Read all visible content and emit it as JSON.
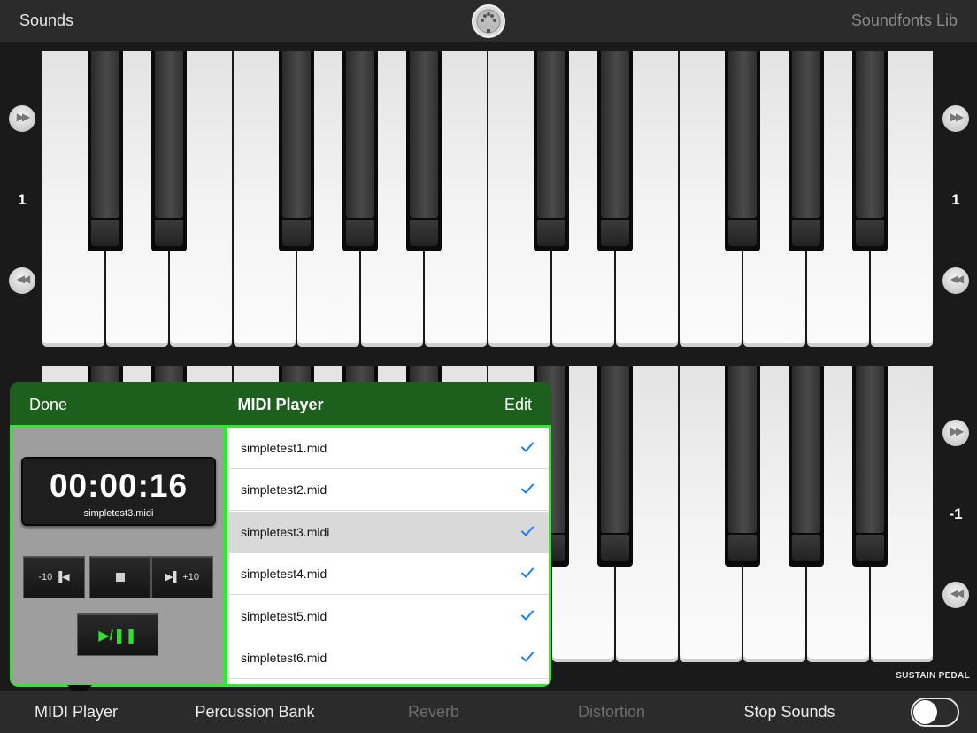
{
  "topbar": {
    "left_label": "Sounds",
    "right_label": "Soundfonts Lib",
    "logo_icon": "midi-connector-icon"
  },
  "keyboard_top": {
    "octave_left": "1",
    "octave_right": "1"
  },
  "keyboard_bottom": {
    "octave_right": "-1",
    "sustain_label": "SUSTAIN PEDAL"
  },
  "popover": {
    "done_label": "Done",
    "title": "MIDI Player",
    "edit_label": "Edit",
    "time": "00:00:16",
    "current_file": "simpletest3.midi",
    "back_label": "-10",
    "fwd_label": "+10",
    "play_label": "▶/❚❚",
    "files": [
      {
        "name": "simpletest1.mid",
        "selected": false
      },
      {
        "name": "simpletest2.mid",
        "selected": false
      },
      {
        "name": "simpletest3.midi",
        "selected": true
      },
      {
        "name": "simpletest4.mid",
        "selected": false
      },
      {
        "name": "simpletest5.mid",
        "selected": false
      },
      {
        "name": "simpletest6.mid",
        "selected": false
      }
    ]
  },
  "toolbar": {
    "items": [
      {
        "label": "MIDI Player",
        "enabled": true
      },
      {
        "label": "Percussion Bank",
        "enabled": true
      },
      {
        "label": "Reverb",
        "enabled": false
      },
      {
        "label": "Distortion",
        "enabled": false
      },
      {
        "label": "Stop Sounds",
        "enabled": true
      }
    ],
    "toggle_on": false
  },
  "colors": {
    "accent_green": "#31e831",
    "header_green": "#1d5f1d",
    "check_blue": "#1a7cf5",
    "disabled_text": "#6d6d6d"
  }
}
